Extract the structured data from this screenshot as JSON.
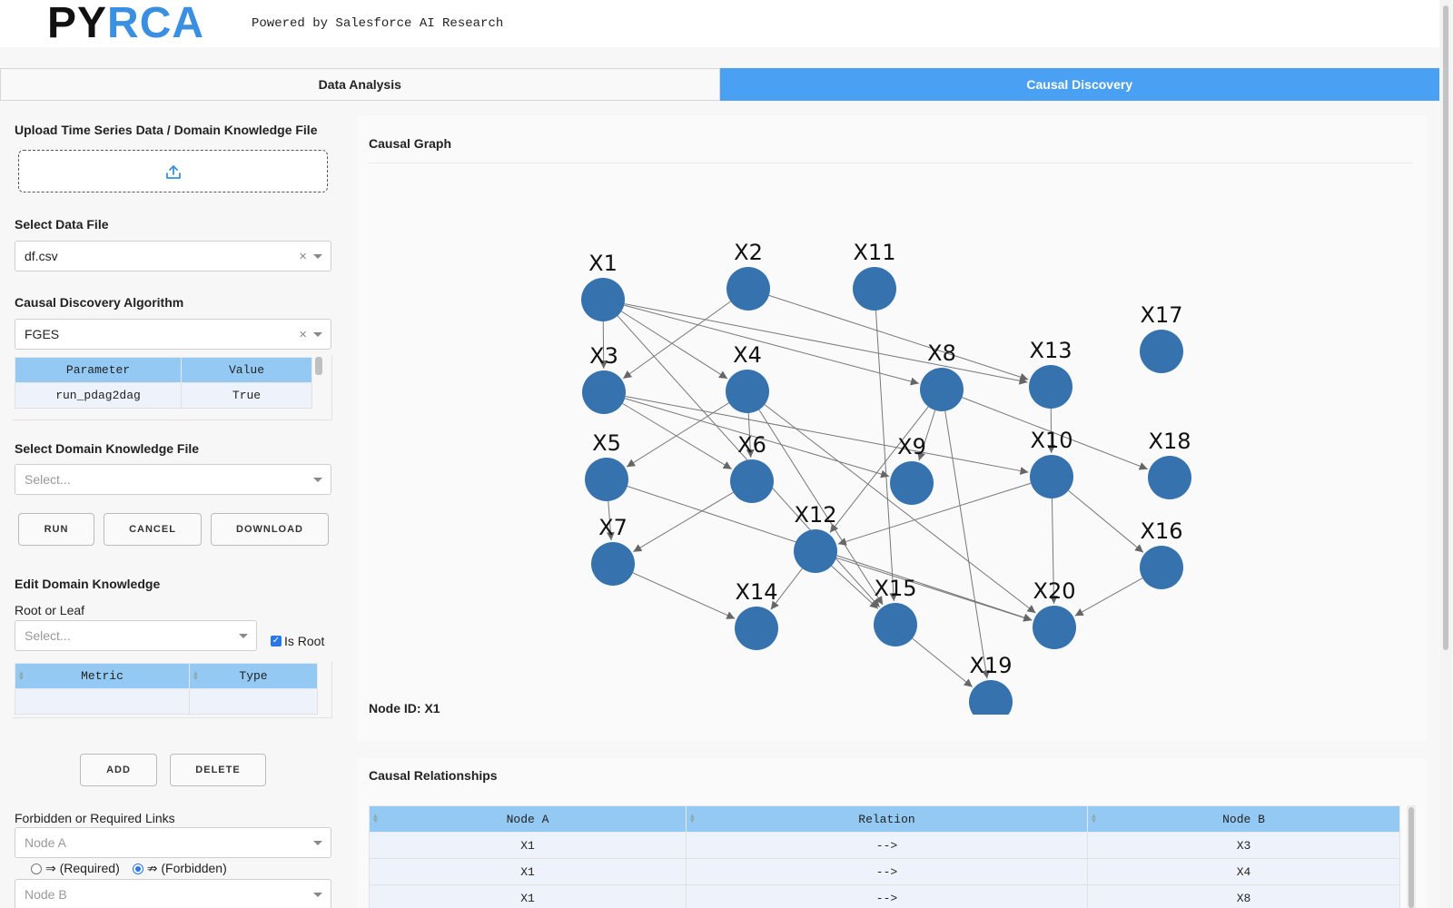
{
  "header": {
    "logo_py": "PY",
    "logo_rca": "RCA",
    "powered_by": "Powered by Salesforce AI Research"
  },
  "tabs": [
    {
      "label": "Data Analysis",
      "active": false
    },
    {
      "label": "Causal Discovery",
      "active": true
    }
  ],
  "left": {
    "upload_label": "Upload Time Series Data / Domain Knowledge File",
    "data_file_label": "Select Data File",
    "data_file_value": "df.csv",
    "algorithm_label": "Causal Discovery Algorithm",
    "algorithm_value": "FGES",
    "param_table": {
      "headers": [
        "Parameter",
        "Value"
      ],
      "rows": [
        [
          "run_pdag2dag",
          "True"
        ]
      ]
    },
    "domain_file_label": "Select Domain Knowledge File",
    "domain_file_placeholder": "Select...",
    "buttons": {
      "run": "RUN",
      "cancel": "CANCEL",
      "download": "DOWNLOAD"
    },
    "edit_label": "Edit Domain Knowledge",
    "root_leaf_label": "Root or Leaf",
    "root_leaf_placeholder": "Select...",
    "is_root_label": "Is Root",
    "is_root_checked": true,
    "metric_table": {
      "headers": [
        "Metric",
        "Type"
      ]
    },
    "add_label": "ADD",
    "delete_label": "DELETE",
    "links_label": "Forbidden or Required Links",
    "node_a_placeholder": "Node A",
    "required_label": "⇒ (Required)",
    "forbidden_label": "⇏ (Forbidden)",
    "forbidden_selected": true,
    "node_b_placeholder": "Node B"
  },
  "graph": {
    "title": "Causal Graph",
    "node_id_text": "Node ID: X1",
    "node_color": "#3572ae",
    "nodes": [
      {
        "id": "X1"
      },
      {
        "id": "X2"
      },
      {
        "id": "X11"
      },
      {
        "id": "X17"
      },
      {
        "id": "X3"
      },
      {
        "id": "X4"
      },
      {
        "id": "X8"
      },
      {
        "id": "X13"
      },
      {
        "id": "X5"
      },
      {
        "id": "X6"
      },
      {
        "id": "X9"
      },
      {
        "id": "X10"
      },
      {
        "id": "X18"
      },
      {
        "id": "X7"
      },
      {
        "id": "X12"
      },
      {
        "id": "X16"
      },
      {
        "id": "X14"
      },
      {
        "id": "X15"
      },
      {
        "id": "X20"
      },
      {
        "id": "X19"
      }
    ],
    "edges": [
      [
        "X1",
        "X3"
      ],
      [
        "X1",
        "X4"
      ],
      [
        "X1",
        "X8"
      ],
      [
        "X1",
        "X13"
      ],
      [
        "X1",
        "X15"
      ],
      [
        "X2",
        "X3"
      ],
      [
        "X2",
        "X13"
      ],
      [
        "X11",
        "X15"
      ],
      [
        "X3",
        "X6"
      ],
      [
        "X3",
        "X9"
      ],
      [
        "X3",
        "X10"
      ],
      [
        "X4",
        "X5"
      ],
      [
        "X4",
        "X6"
      ],
      [
        "X4",
        "X15"
      ],
      [
        "X4",
        "X20"
      ],
      [
        "X8",
        "X9"
      ],
      [
        "X8",
        "X12"
      ],
      [
        "X8",
        "X18"
      ],
      [
        "X8",
        "X19"
      ],
      [
        "X13",
        "X10"
      ],
      [
        "X5",
        "X7"
      ],
      [
        "X5",
        "X20"
      ],
      [
        "X6",
        "X7"
      ],
      [
        "X10",
        "X12"
      ],
      [
        "X10",
        "X16"
      ],
      [
        "X10",
        "X20"
      ],
      [
        "X7",
        "X14"
      ],
      [
        "X12",
        "X14"
      ],
      [
        "X12",
        "X15"
      ],
      [
        "X12",
        "X20"
      ],
      [
        "X15",
        "X19"
      ],
      [
        "X16",
        "X20"
      ]
    ]
  },
  "relationships": {
    "title": "Causal Relationships",
    "headers": [
      "Node A",
      "Relation",
      "Node B"
    ],
    "rows": [
      [
        "X1",
        "-->",
        "X3"
      ],
      [
        "X1",
        "-->",
        "X4"
      ],
      [
        "X1",
        "-->",
        "X8"
      ]
    ]
  }
}
